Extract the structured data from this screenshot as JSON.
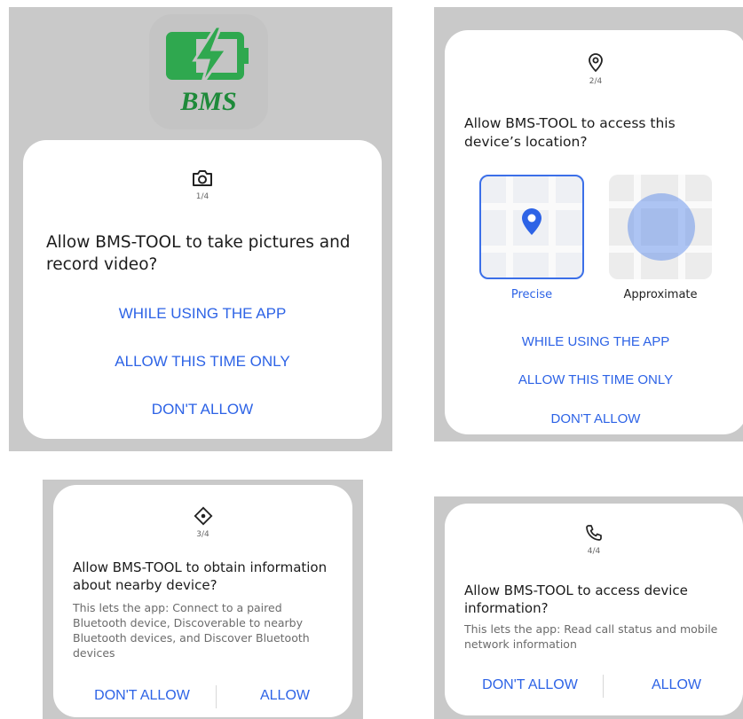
{
  "app_logo": {
    "text": "BMS",
    "accent": "#2fa84f"
  },
  "accent_color": "#2d63e6",
  "dialogs": [
    {
      "step": "1/4",
      "icon": "camera-icon",
      "title": "Allow BMS-TOOL to take pictures and record video?",
      "buttons": [
        "WHILE USING THE APP",
        "ALLOW THIS TIME ONLY",
        "DON'T ALLOW"
      ]
    },
    {
      "step": "2/4",
      "icon": "location-pin-icon",
      "title": "Allow BMS-TOOL to access this device’s location?",
      "options": {
        "precise": "Precise",
        "approximate": "Approximate",
        "selected": "Precise"
      },
      "buttons": [
        "WHILE USING THE APP",
        "ALLOW THIS TIME ONLY",
        "DON'T ALLOW"
      ]
    },
    {
      "step": "3/4",
      "icon": "nearby-device-icon",
      "title": "Allow BMS-TOOL to obtain information about nearby device?",
      "description": "This lets the app: Connect to a paired Bluetooth device, Discoverable to nearby Bluetooth devices, and Discover Bluetooth devices",
      "buttons": [
        "DON'T ALLOW",
        "ALLOW"
      ]
    },
    {
      "step": "4/4",
      "icon": "phone-icon",
      "title": "Allow BMS-TOOL to access device information?",
      "description": "This lets the app: Read call status and mobile network information",
      "buttons": [
        "DON'T ALLOW",
        "ALLOW"
      ]
    }
  ]
}
